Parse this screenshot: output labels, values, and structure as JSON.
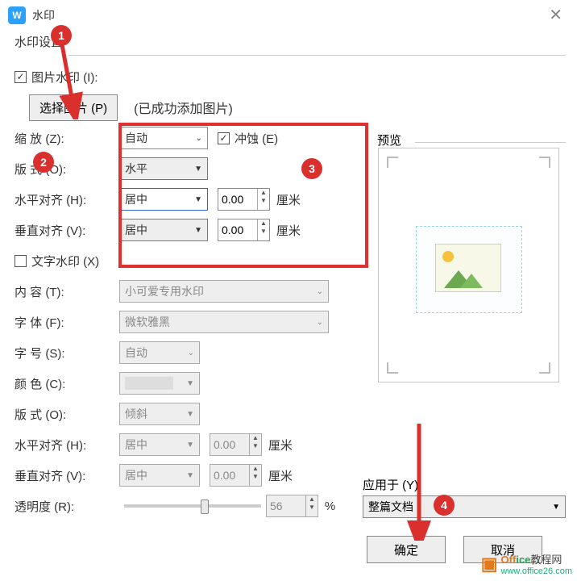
{
  "window": {
    "title": "水印",
    "close": "✕"
  },
  "section": {
    "settings_label": "水印设置"
  },
  "image_wm": {
    "checkbox_label": "图片水印 (I):",
    "checked": true,
    "select_btn": "选择图片 (P)",
    "status": "(已成功添加图片)",
    "zoom_label": "缩    放 (Z):",
    "zoom_value": "自动",
    "erode_label": "冲蚀 (E)",
    "erode_checked": true,
    "layout_label": "版    式 (O):",
    "layout_value": "水平",
    "halign_label": "水平对齐 (H):",
    "halign_value": "居中",
    "halign_offset": "0.00",
    "valign_label": "垂直对齐 (V):",
    "valign_value": "居中",
    "valign_offset": "0.00",
    "unit": "厘米"
  },
  "text_wm": {
    "checkbox_label": "文字水印 (X)",
    "checked": false,
    "content_label": "内    容 (T):",
    "content_value": "小可爱专用水印",
    "font_label": "字    体 (F):",
    "font_value": "微软雅黑",
    "size_label": "字    号 (S):",
    "size_value": "自动",
    "color_label": "颜    色 (C):",
    "layout_label": "版    式 (O):",
    "layout_value": "倾斜",
    "halign_label": "水平对齐 (H):",
    "halign_value": "居中",
    "halign_offset": "0.00",
    "valign_label": "垂直对齐 (V):",
    "valign_value": "居中",
    "valign_offset": "0.00",
    "opacity_label": "透明度 (R):",
    "opacity_value": "56",
    "opacity_percent": "%",
    "unit": "厘米"
  },
  "preview": {
    "label": "预览"
  },
  "apply": {
    "label": "应用于 (Y):",
    "value": "整篇文档"
  },
  "buttons": {
    "ok": "确定",
    "cancel": "取消"
  },
  "markers": {
    "m1": "1",
    "m2": "2",
    "m3": "3",
    "m4": "4"
  },
  "branding": {
    "name_colored": "Office教程网",
    "url": "www.office26.com"
  }
}
